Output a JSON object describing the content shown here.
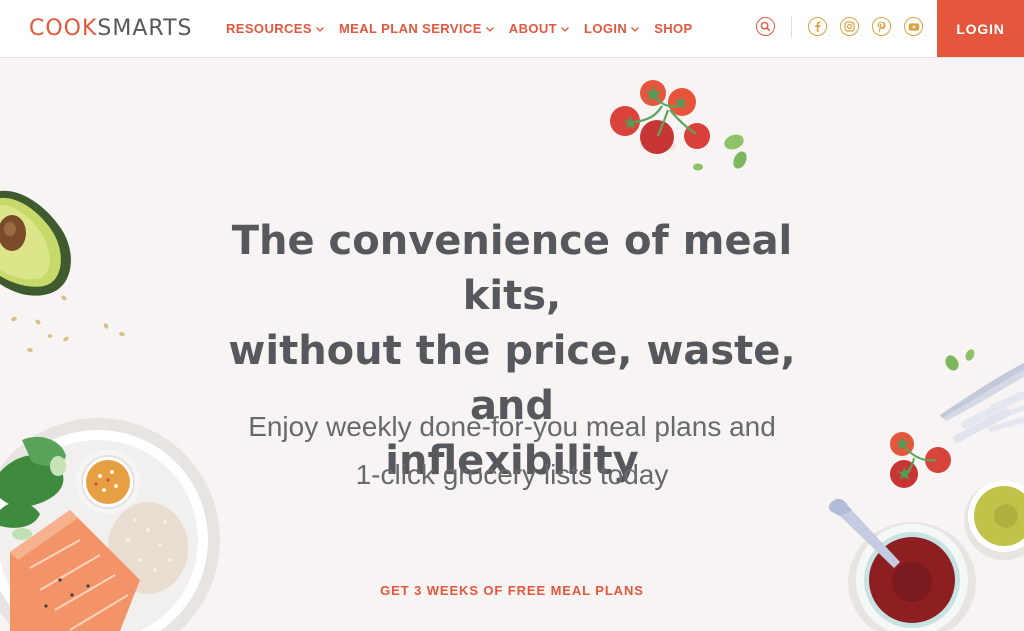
{
  "header": {
    "logo_part1": "COOK",
    "logo_part2": "SMARTS",
    "nav": [
      {
        "label": "RESOURCES",
        "has_dropdown": true
      },
      {
        "label": "MEAL PLAN SERVICE",
        "has_dropdown": true
      },
      {
        "label": "ABOUT",
        "has_dropdown": true
      },
      {
        "label": "LOGIN",
        "has_dropdown": true
      },
      {
        "label": "SHOP",
        "has_dropdown": false
      }
    ],
    "icons": [
      "search-icon",
      "facebook-icon",
      "instagram-icon",
      "pinterest-icon",
      "youtube-icon"
    ],
    "login_button": "LOGIN"
  },
  "hero": {
    "headline_line1": "The convenience of meal kits,",
    "headline_line2": "without the price, waste, and",
    "headline_line3": "inflexibility",
    "subline_line1": "Enjoy weekly done-for-you meal plans and",
    "subline_line2": "1-click grocery lists today",
    "cta": "GET 3 WEEKS OF FREE MEAL PLANS"
  },
  "colors": {
    "accent": "#e4573d",
    "social_icon": "#d9a442",
    "text": "#56585d",
    "background": "#f8f4f3"
  }
}
